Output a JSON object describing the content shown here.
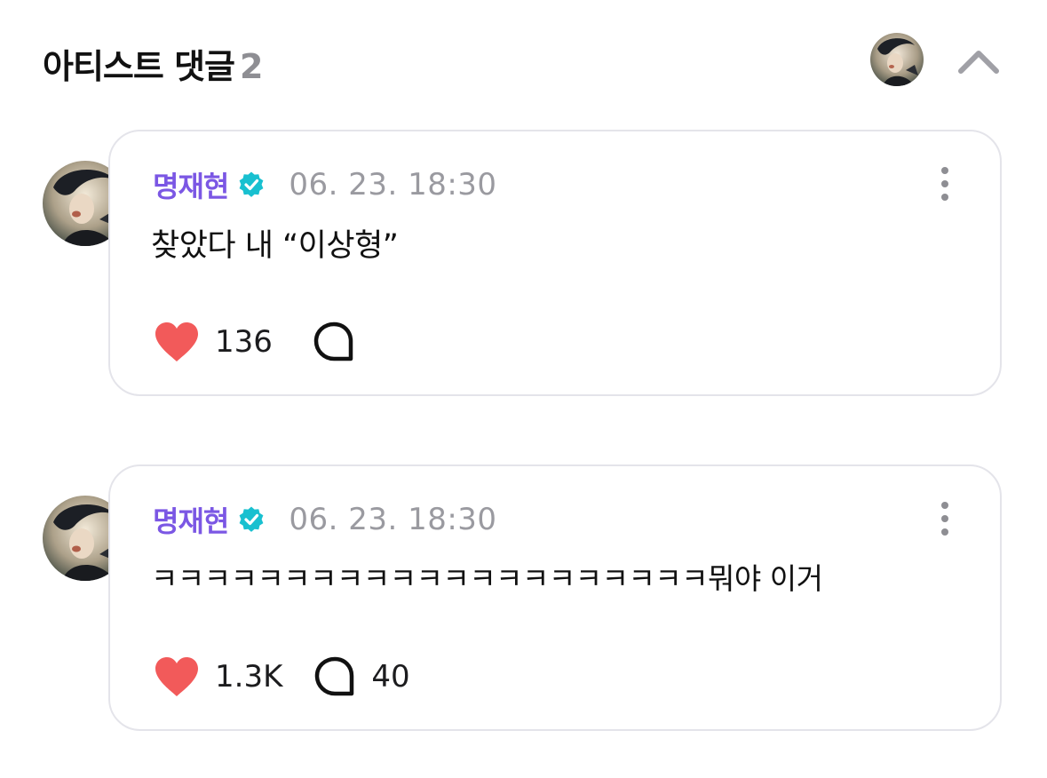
{
  "header": {
    "title": "아티스트 댓글",
    "count": "2",
    "avatar_icon": "artist-avatar",
    "collapse_icon": "chevron-up-icon"
  },
  "colors": {
    "author": "#7b57e4",
    "verified": "#18c0d0",
    "heart": "#f25a5a",
    "timestamp": "#9a9aa0",
    "card_border": "#e4e4ea"
  },
  "comments": [
    {
      "author": "명재현",
      "timestamp": "06. 23. 18:30",
      "text": "찾았다 내 “이상형”",
      "likes": "136",
      "replies": ""
    },
    {
      "author": "명재현",
      "timestamp": "06. 23. 18:30",
      "text": "ㅋㅋㅋㅋㅋㅋㅋㅋㅋㅋㅋㅋㅋㅋㅋㅋㅋㅋㅋㅋㅋ뭐야 이거",
      "likes": "1.3K",
      "replies": "40"
    }
  ]
}
